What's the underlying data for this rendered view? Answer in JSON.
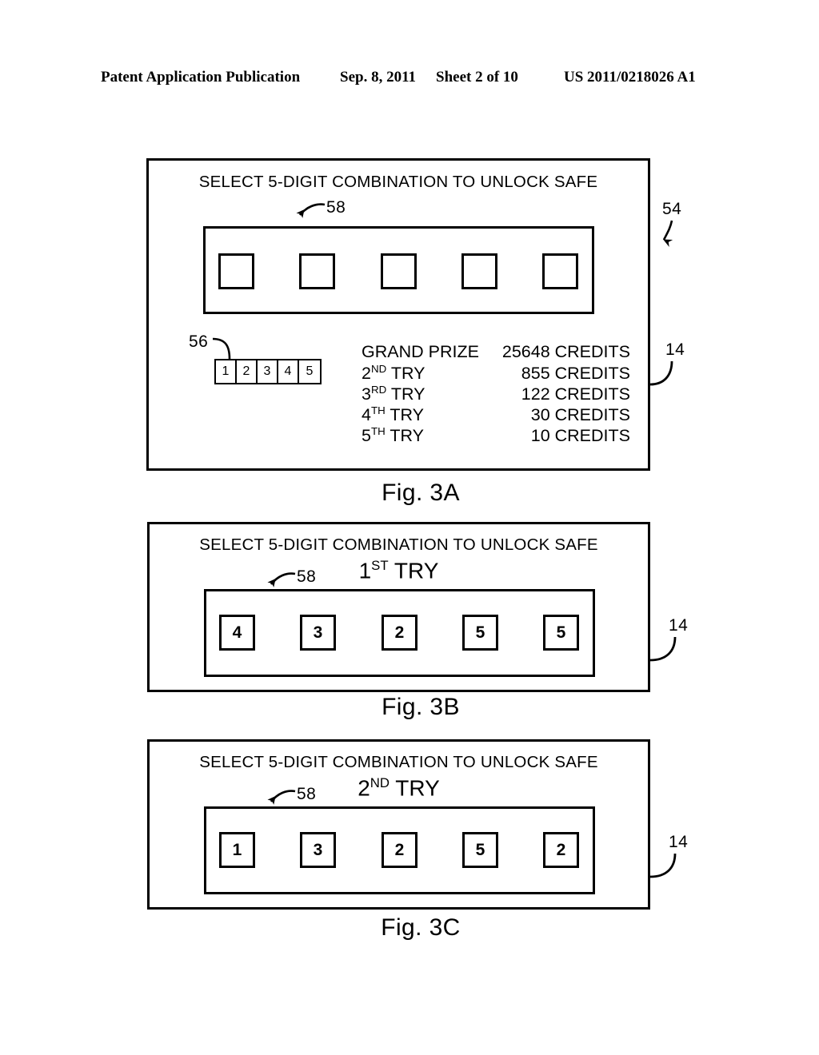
{
  "header": {
    "publication": "Patent Application Publication",
    "date": "Sep. 8, 2011",
    "sheet": "Sheet 2 of 10",
    "doc_number": "US 2011/0218026 A1"
  },
  "figures": [
    {
      "id": "fig3a",
      "caption": "Fig. 3A",
      "prompt": "SELECT 5-DIGIT COMBINATION TO UNLOCK SAFE",
      "try_heading": "",
      "try_heading_ordinal": "",
      "digits": [
        "",
        "",
        "",
        "",
        ""
      ],
      "reference_numerals": [
        "58",
        "56",
        "54",
        "14"
      ]
    },
    {
      "id": "fig3b",
      "caption": "Fig. 3B",
      "prompt": "SELECT 5-DIGIT COMBINATION TO UNLOCK SAFE",
      "try_heading": "1",
      "try_heading_ordinal": "ST",
      "try_heading_suffix": " TRY",
      "digits": [
        "4",
        "3",
        "2",
        "5",
        "5"
      ],
      "reference_numerals": [
        "58",
        "14"
      ]
    },
    {
      "id": "fig3c",
      "caption": "Fig. 3C",
      "prompt": "SELECT 5-DIGIT COMBINATION TO UNLOCK SAFE",
      "try_heading": "2",
      "try_heading_ordinal": "ND",
      "try_heading_suffix": " TRY",
      "digits": [
        "1",
        "3",
        "2",
        "5",
        "2"
      ],
      "reference_numerals": [
        "58",
        "14"
      ]
    }
  ],
  "index_strip": {
    "reference": "56",
    "cells": [
      "1",
      "2",
      "3",
      "4",
      "5"
    ]
  },
  "prize_table": {
    "rows": [
      {
        "label": "GRAND PRIZE",
        "ordinal": "",
        "value": "25648 CREDITS"
      },
      {
        "label": "2",
        "ordinal": "ND",
        "suffix": " TRY",
        "value": "855 CREDITS"
      },
      {
        "label": "3",
        "ordinal": "RD",
        "suffix": " TRY",
        "value": "122 CREDITS"
      },
      {
        "label": "4",
        "ordinal": "TH",
        "suffix": " TRY",
        "value": "30 CREDITS"
      },
      {
        "label": "5",
        "ordinal": "TH",
        "suffix": " TRY",
        "value": "10 CREDITS"
      }
    ]
  },
  "reference_numerals": {
    "display_housing": "58",
    "index_strip": "56",
    "game_screen": "54",
    "gaming_machine": "14"
  },
  "colors": {
    "ink": "#000000",
    "paper": "#ffffff"
  }
}
